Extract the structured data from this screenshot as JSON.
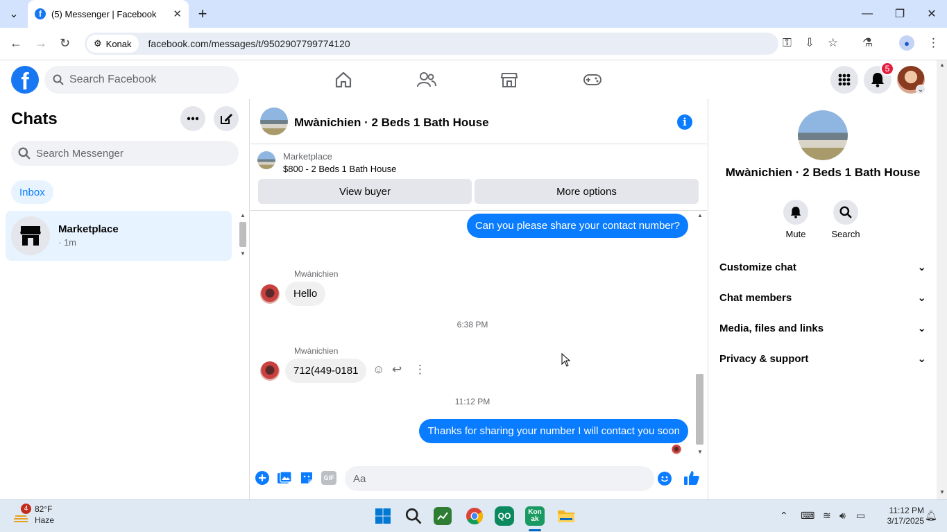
{
  "browser": {
    "tab_title": "(5) Messenger | Facebook",
    "site_chip": "Konak",
    "url": "facebook.com/messages/t/9502907799774120"
  },
  "facebook": {
    "search_placeholder": "Search Facebook",
    "notification_count": "5"
  },
  "sidebar": {
    "title": "Chats",
    "search_placeholder": "Search Messenger",
    "inbox_label": "Inbox",
    "chats": [
      {
        "name": "Marketplace",
        "sub": "· 1m"
      }
    ]
  },
  "conversation": {
    "title": "Mwànichien · 2 Beds 1 Bath House",
    "marketplace_label": "Marketplace",
    "listing": "$800 - 2 Beds 1 Bath House",
    "view_buyer_label": "View buyer",
    "more_options_label": "More options",
    "messages": {
      "m1": "Can you please share your contact number?",
      "sender1": "Mwànichien",
      "m2": "Hello",
      "time1": "6:38 PM",
      "sender2": "Mwànichien",
      "m3": "712(449-0181",
      "time2": "11:12 PM",
      "m4": "Thanks for sharing your number I will contact you soon"
    },
    "composer_placeholder": "Aa",
    "gif_label": "GIF"
  },
  "details": {
    "title": "Mwànichien · 2 Beds 1 Bath House",
    "mute_label": "Mute",
    "search_label": "Search",
    "sections": [
      "Customize chat",
      "Chat members",
      "Media, files and links",
      "Privacy & support"
    ]
  },
  "taskbar": {
    "weather_badge": "4",
    "temperature": "82°F",
    "condition": "Haze",
    "time": "11:12 PM",
    "date": "3/17/2025",
    "konak_label": "Kon\nak"
  },
  "colors": {
    "facebook_blue": "#1877f2",
    "messenger_blue": "#0a7cff",
    "badge_red": "#e41e3f"
  }
}
